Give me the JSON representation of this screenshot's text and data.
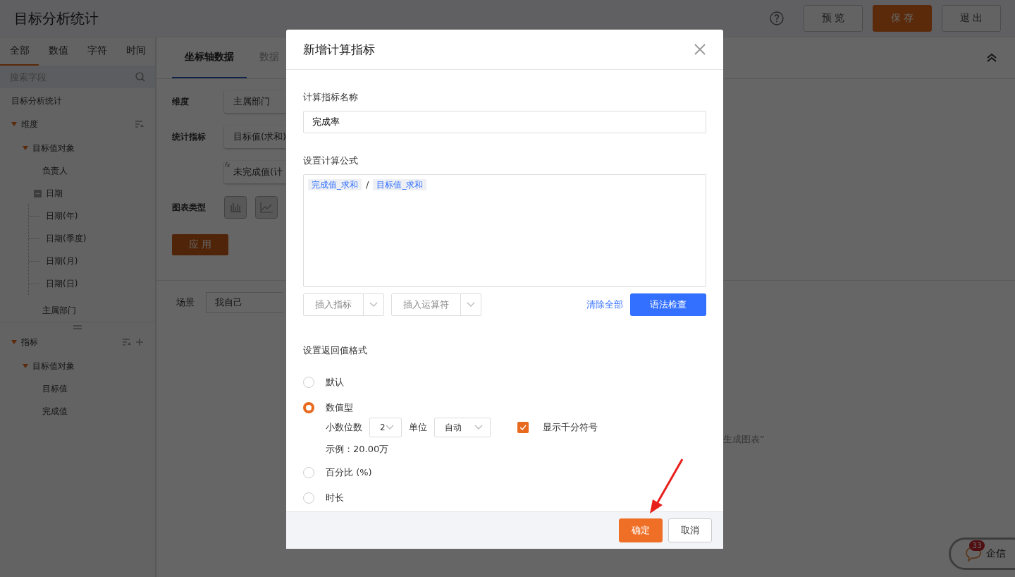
{
  "header": {
    "title": "目标分析统计",
    "buttons": [
      {
        "label": "预 览",
        "kind": "default"
      },
      {
        "label": "保 存",
        "kind": "primary"
      },
      {
        "label": "退 出",
        "kind": "default"
      }
    ]
  },
  "field_panel": {
    "tabs": [
      {
        "label": "全部",
        "selected": true
      },
      {
        "label": "数值",
        "selected": false
      },
      {
        "label": "字符",
        "selected": false
      },
      {
        "label": "时间",
        "selected": false
      }
    ],
    "search": {
      "placeholder": "搜索字段"
    },
    "root": "目标分析统计",
    "sections": [
      {
        "label": "维度",
        "expanded": true,
        "can_add": false,
        "children": [
          {
            "label": "目标值对象",
            "kind": "caret",
            "expanded": true,
            "children": [
              {
                "label": "负责人",
                "kind": "leaf"
              },
              {
                "label": "日期",
                "kind": "box",
                "expanded": true,
                "children": [
                  {
                    "label": "日期(年)",
                    "kind": "leaf"
                  },
                  {
                    "label": "日期(季度)",
                    "kind": "leaf"
                  },
                  {
                    "label": "日期(月)",
                    "kind": "leaf"
                  },
                  {
                    "label": "日期(日)",
                    "kind": "leaf"
                  }
                ]
              },
              {
                "label": "主属部门",
                "kind": "leaf"
              }
            ]
          }
        ]
      },
      {
        "label": "指标",
        "expanded": true,
        "can_add": true,
        "children": [
          {
            "label": "目标值对象",
            "kind": "caret",
            "expanded": true,
            "children": [
              {
                "label": "目标值",
                "kind": "leaf"
              },
              {
                "label": "完成值",
                "kind": "leaf"
              }
            ]
          }
        ]
      }
    ]
  },
  "config": {
    "tabs": [
      {
        "label": "坐标轴数据",
        "selected": true
      },
      {
        "label": "数据",
        "selected": false
      }
    ],
    "rows": [
      {
        "label": "维度",
        "chips": [
          {
            "text": "主属部门"
          }
        ]
      },
      {
        "label": "统计指标",
        "chips": [
          {
            "text": "目标值(求和)"
          },
          {
            "text": "未完成值(计",
            "mark": "fx"
          }
        ]
      }
    ],
    "chart_type_label": "图表类型",
    "apply": "应 用",
    "scene": {
      "label": "场景",
      "value": "我自己"
    },
    "hint": "生成图表”"
  },
  "dialog": {
    "title": "新增计算指标",
    "name_label": "计算指标名称",
    "name_value": "完成率",
    "formula_label": "设置计算公式",
    "formula": [
      {
        "kind": "field",
        "text": "完成值_求和"
      },
      {
        "kind": "operator",
        "text": "/"
      },
      {
        "kind": "field",
        "text": "目标值_求和"
      }
    ],
    "inserts": [
      "插入指标",
      "插入运算符"
    ],
    "clear": "清除全部",
    "check": "语法检查",
    "format_label": "设置返回值格式",
    "formats": [
      {
        "label": "默认",
        "selected": false
      },
      {
        "label": "数值型",
        "selected": true,
        "details": {
          "decimals": {
            "label": "小数位数",
            "value": "2"
          },
          "unit": {
            "label": "单位",
            "value": "自动"
          },
          "thousands": {
            "label": "显示千分符号",
            "checked": true
          },
          "example": "示例：20.00万"
        }
      },
      {
        "label": "百分比 (%)",
        "selected": false
      },
      {
        "label": "时长",
        "selected": false
      }
    ],
    "buttons": [
      {
        "label": "确定",
        "kind": "primary"
      },
      {
        "label": "取消",
        "kind": "default"
      }
    ]
  },
  "chat": {
    "badge": "33",
    "label": "企信"
  }
}
